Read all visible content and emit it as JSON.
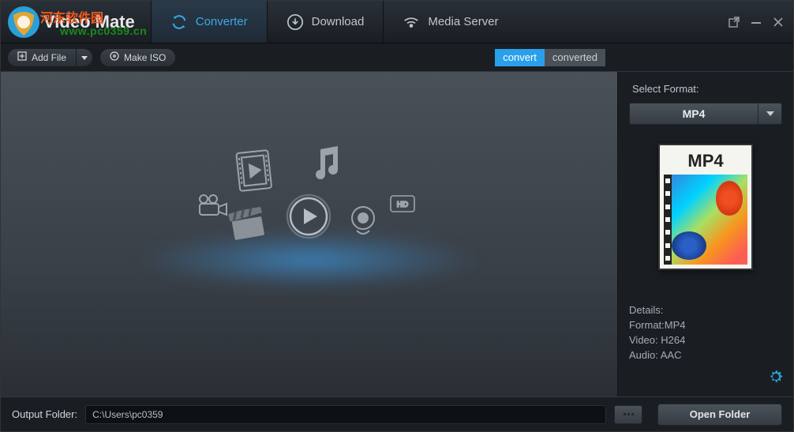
{
  "app": {
    "title": "Video Mate"
  },
  "watermark": {
    "text": "河东软件园",
    "url": "www.pc0359.cn"
  },
  "tabs": {
    "converter": "Converter",
    "download": "Download",
    "media_server": "Media Server"
  },
  "toolbar": {
    "add_file": "Add File",
    "make_iso": "Make ISO",
    "seg_convert": "convert",
    "seg_converted": "converted"
  },
  "sidebar": {
    "select_format": "Select Format:",
    "format": "MP4",
    "card_label": "MP4",
    "details_title": "Details:",
    "details_format": "Format:MP4",
    "details_video": "Video: H264",
    "details_audio": "Audio: AAC"
  },
  "bottom": {
    "label": "Output Folder:",
    "path": "C:\\Users\\pc0359",
    "open_folder": "Open Folder"
  }
}
